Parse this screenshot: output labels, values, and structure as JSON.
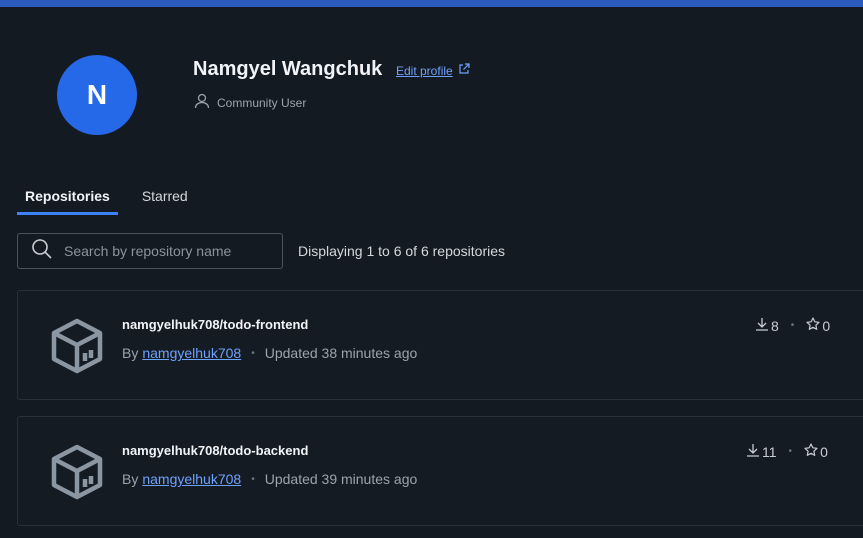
{
  "profile": {
    "initial": "N",
    "name": "Namgyel Wangchuk",
    "edit_label": "Edit profile",
    "role": "Community User",
    "avatar_color": "#2669e8"
  },
  "tabs": [
    {
      "label": "Repositories",
      "active": true
    },
    {
      "label": "Starred",
      "active": false
    }
  ],
  "search": {
    "placeholder": "Search by repository name",
    "value": ""
  },
  "display_count": "Displaying 1 to 6 of 6 repositories",
  "repos": [
    {
      "name": "namgyelhuk708/todo-frontend",
      "by": "By",
      "owner": "namgyelhuk708",
      "updated": "Updated 38 minutes ago",
      "pulls": "8",
      "stars": "0"
    },
    {
      "name": "namgyelhuk708/todo-backend",
      "by": "By",
      "owner": "namgyelhuk708",
      "updated": "Updated 39 minutes ago",
      "pulls": "11",
      "stars": "0"
    }
  ],
  "icons": [
    "person-icon",
    "external-link-icon",
    "search-icon",
    "repo-cube-icon",
    "download-icon",
    "star-icon"
  ]
}
